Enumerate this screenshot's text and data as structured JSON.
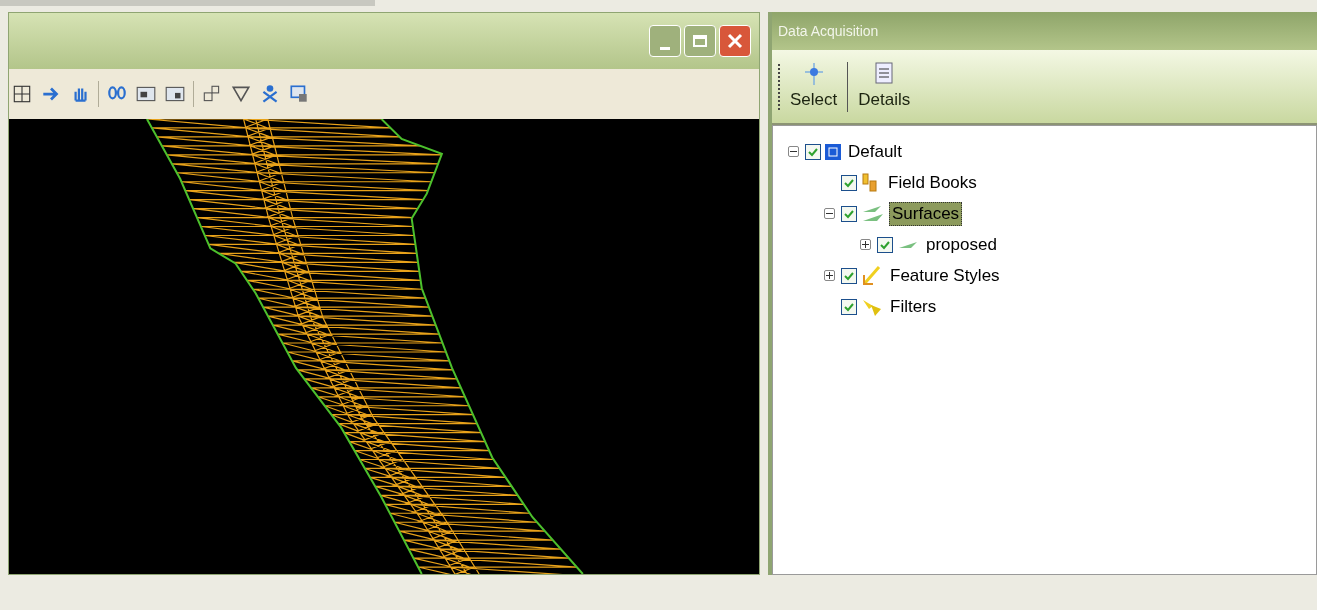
{
  "panel": {
    "title": "Data Acquisition",
    "toolbar": [
      {
        "kind": "select",
        "label": "Select"
      },
      {
        "kind": "details",
        "label": "Details"
      }
    ]
  },
  "tree": [
    {
      "label": "Default",
      "kind": "project",
      "checked": true,
      "selected": false,
      "expanded": true,
      "children": [
        {
          "label": "Field Books",
          "kind": "fieldbooks",
          "checked": true,
          "selected": false
        },
        {
          "label": "Surfaces",
          "kind": "surfaces",
          "checked": true,
          "selected": true,
          "expanded": true,
          "children": [
            {
              "label": "proposed",
              "kind": "surface",
              "checked": true,
              "selected": false,
              "expanded": false
            }
          ]
        },
        {
          "label": "Feature Styles",
          "kind": "styles",
          "checked": true,
          "selected": false,
          "expanded": false
        },
        {
          "label": "Filters",
          "kind": "filters",
          "checked": true,
          "selected": false
        }
      ]
    }
  ]
}
